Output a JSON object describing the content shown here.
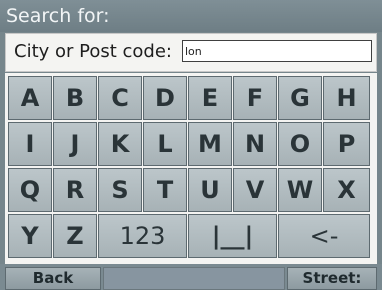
{
  "header": {
    "title": "Search for:"
  },
  "search": {
    "label": "City or Post code:",
    "value": "lon"
  },
  "keyboard": {
    "row1": [
      "A",
      "B",
      "C",
      "D",
      "E",
      "F",
      "G",
      "H"
    ],
    "row2": [
      "I",
      "J",
      "K",
      "L",
      "M",
      "N",
      "O",
      "P"
    ],
    "row3": [
      "Q",
      "R",
      "S",
      "T",
      "U",
      "V",
      "W",
      "X"
    ],
    "row4": {
      "y": "Y",
      "z": "Z",
      "numbers": "123",
      "space": "|__|",
      "backspace": "<-"
    }
  },
  "footer": {
    "back_label": "Back",
    "street_label": "Street:"
  }
}
